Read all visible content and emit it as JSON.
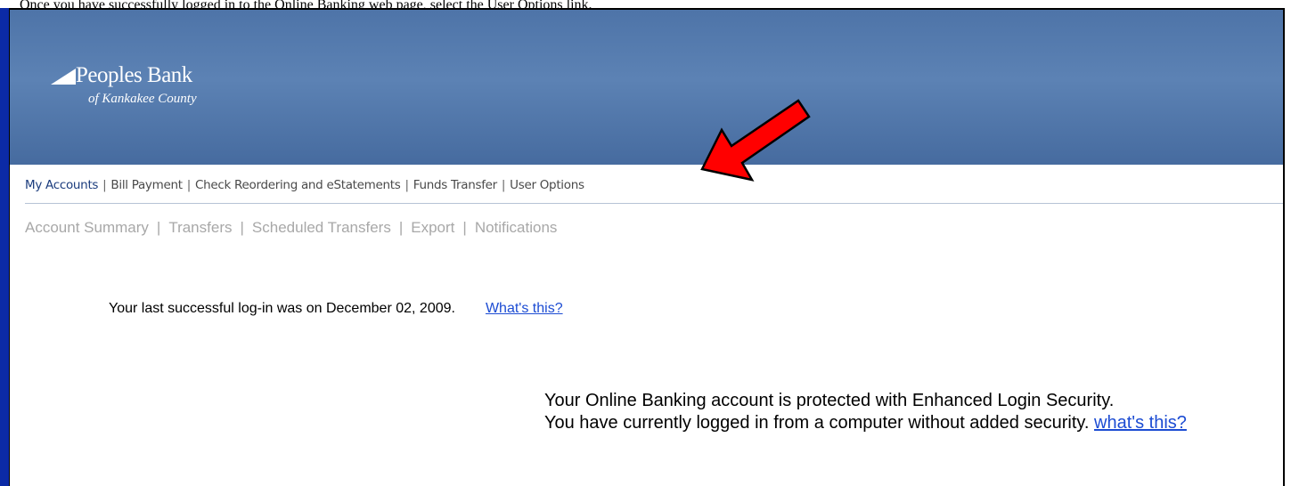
{
  "caption": "Once you have successfully logged in to the Online Banking web page, select the User Options link.",
  "bank": {
    "name": "Peoples Bank",
    "subtitle": "of Kankakee County"
  },
  "nav_primary": [
    {
      "label": "My Accounts",
      "active": true
    },
    {
      "label": "Bill Payment"
    },
    {
      "label": "Check Reordering and eStatements"
    },
    {
      "label": "Funds Transfer"
    },
    {
      "label": "User Options"
    }
  ],
  "nav_secondary": [
    {
      "label": "Account Summary"
    },
    {
      "label": "Transfers"
    },
    {
      "label": "Scheduled Transfers"
    },
    {
      "label": "Export"
    },
    {
      "label": "Notifications"
    }
  ],
  "login_info": {
    "text": "Your last successful log-in was on December 02, 2009.",
    "link": "What's this?"
  },
  "security": {
    "line1": "Your Online Banking account is protected with Enhanced Login Security.",
    "line2": "You have currently logged in from a computer without added security.",
    "link": "what's this?"
  },
  "colors": {
    "banner": "#5279ad",
    "arrow": "#ff0000",
    "link": "#1c4cd3",
    "left_bar": "#0b2aa6"
  }
}
